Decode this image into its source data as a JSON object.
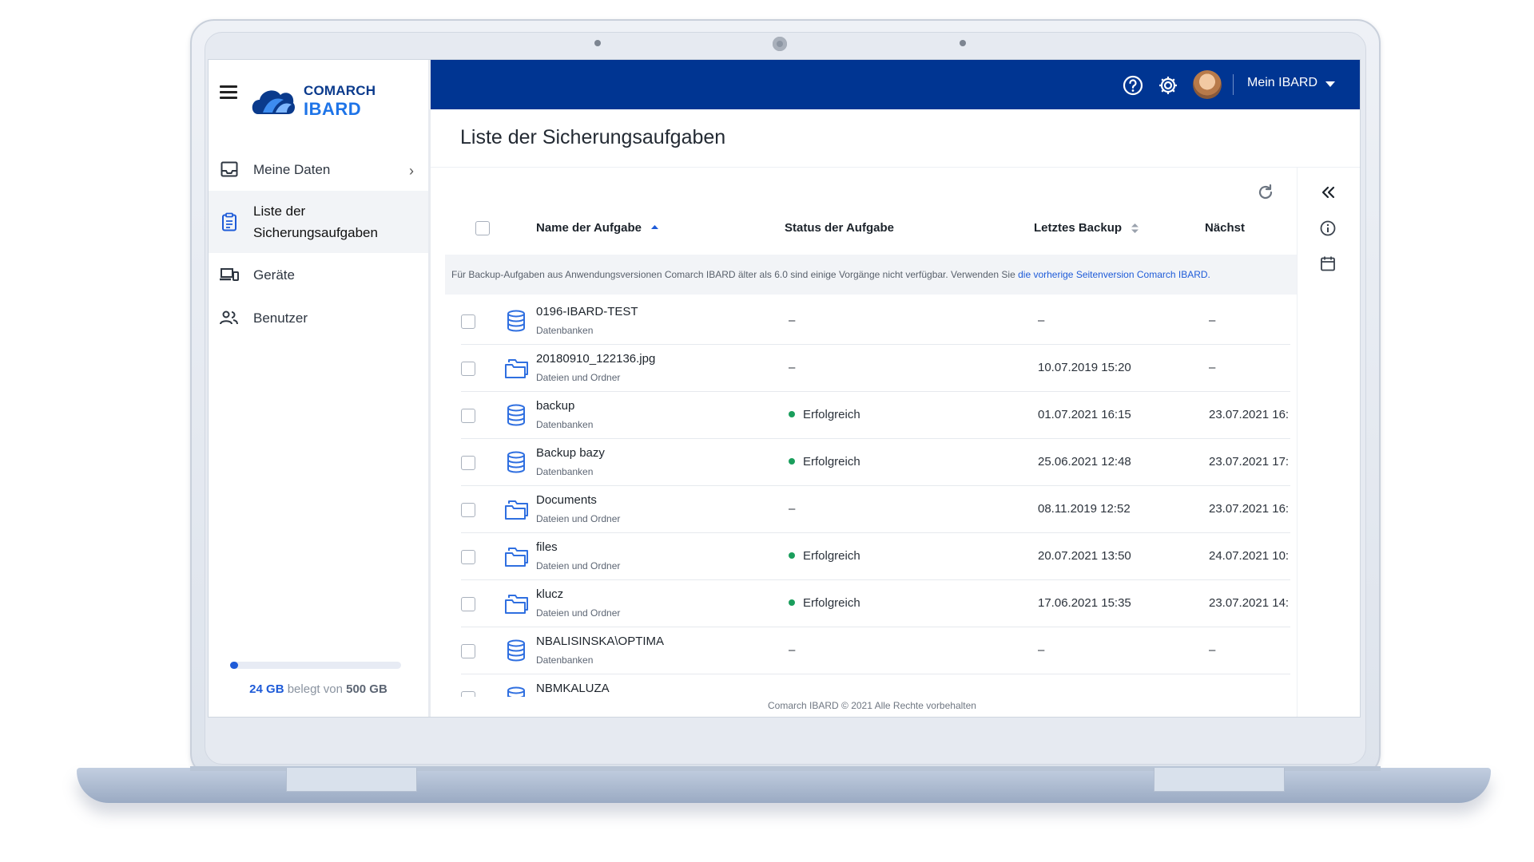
{
  "app": {
    "brand_top": "COMARCH",
    "brand_bottom": "IBARD"
  },
  "sidebar": {
    "items": [
      {
        "label": "Meine Daten",
        "icon": "inbox-icon",
        "has_chevron": true
      },
      {
        "label": "Liste der Sicherungsaufgaben",
        "icon": "clipboard-icon",
        "active": true
      },
      {
        "label": "Geräte",
        "icon": "devices-icon"
      },
      {
        "label": "Benutzer",
        "icon": "users-icon"
      }
    ],
    "storage": {
      "used": "24 GB",
      "middle": "belegt von",
      "total": "500 GB",
      "fraction_used": 0.048
    }
  },
  "topbar": {
    "account_label": "Mein IBARD",
    "icons": [
      "help-icon",
      "settings-icon",
      "avatar"
    ]
  },
  "page": {
    "title": "Liste der Sicherungsaufgaben"
  },
  "table": {
    "columns": {
      "name": "Name der Aufgabe",
      "status": "Status der Aufgabe",
      "last_backup": "Letztes Backup",
      "next": "Nächst"
    },
    "notice_text": "Für Backup-Aufgaben aus Anwendungsversionen Comarch IBARD älter als 6.0 sind einige Vorgänge nicht verfügbar. Verwenden Sie ",
    "notice_link": "die vorherige Seitenversion Comarch IBARD.",
    "rows": [
      {
        "name": "0196-IBARD-TEST",
        "type": "Datenbanken",
        "kind": "database",
        "status": "–",
        "status_ok": false,
        "last": "–",
        "next": "–"
      },
      {
        "name": "20180910_122136.jpg",
        "type": "Dateien und Ordner",
        "kind": "folder",
        "status": "–",
        "status_ok": false,
        "last": "10.07.2019 15:20",
        "next": "–"
      },
      {
        "name": "backup",
        "type": "Datenbanken",
        "kind": "database",
        "status": "Erfolgreich",
        "status_ok": true,
        "last": "01.07.2021 16:15",
        "next": "23.07.2021 16:"
      },
      {
        "name": "Backup bazy",
        "type": "Datenbanken",
        "kind": "database",
        "status": "Erfolgreich",
        "status_ok": true,
        "last": "25.06.2021 12:48",
        "next": "23.07.2021 17:"
      },
      {
        "name": "Documents",
        "type": "Dateien und Ordner",
        "kind": "folder",
        "status": "–",
        "status_ok": false,
        "last": "08.11.2019 12:52",
        "next": "23.07.2021 16:"
      },
      {
        "name": "files",
        "type": "Dateien und Ordner",
        "kind": "folder",
        "status": "Erfolgreich",
        "status_ok": true,
        "last": "20.07.2021 13:50",
        "next": "24.07.2021 10:"
      },
      {
        "name": "klucz",
        "type": "Dateien und Ordner",
        "kind": "folder",
        "status": "Erfolgreich",
        "status_ok": true,
        "last": "17.06.2021 15:35",
        "next": "23.07.2021 14:"
      },
      {
        "name": "NBALISINSKA\\OPTIMA",
        "type": "Datenbanken",
        "kind": "database",
        "status": "–",
        "status_ok": false,
        "last": "–",
        "next": "–"
      },
      {
        "name": "NBMKALUZA",
        "type": "",
        "kind": "database",
        "status": "",
        "status_ok": false,
        "last": "",
        "next": ""
      }
    ]
  },
  "footer": "Comarch IBARD © 2021 Alle Rechte vorbehalten",
  "colors": {
    "topbar": "#003592",
    "accent": "#1e5bd8",
    "success": "#1a9e5c"
  }
}
